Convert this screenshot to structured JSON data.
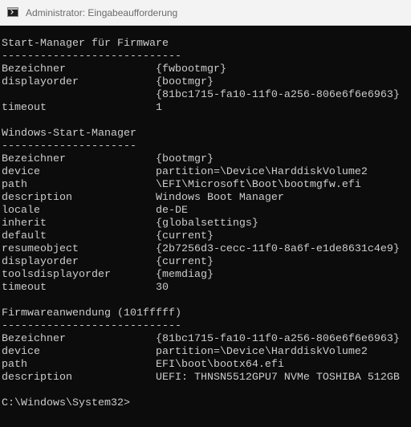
{
  "window": {
    "title": "Administrator: Eingabeaufforderung",
    "icon": "cmd-prompt-icon"
  },
  "console": {
    "lines": [
      "Start-Manager für Firmware",
      "----------------------------",
      "Bezeichner              {fwbootmgr}",
      "displayorder            {bootmgr}",
      "                        {81bc1715-fa10-11f0-a256-806e6f6e6963}",
      "timeout                 1",
      "",
      "Windows-Start-Manager",
      "---------------------",
      "Bezeichner              {bootmgr}",
      "device                  partition=\\Device\\HarddiskVolume2",
      "path                    \\EFI\\Microsoft\\Boot\\bootmgfw.efi",
      "description             Windows Boot Manager",
      "locale                  de-DE",
      "inherit                 {globalsettings}",
      "default                 {current}",
      "resumeobject            {2b7256d3-cecc-11f0-8a6f-e1de8631c4e9}",
      "displayorder            {current}",
      "toolsdisplayorder       {memdiag}",
      "timeout                 30",
      "",
      "Firmwareanwendung (101fffff)",
      "----------------------------",
      "Bezeichner              {81bc1715-fa10-11f0-a256-806e6f6e6963}",
      "device                  partition=\\Device\\HarddiskVolume2",
      "path                    EFI\\boot\\bootx64.efi",
      "description             UEFI: THNSN5512GPU7 NVMe TOSHIBA 512GB",
      "",
      "C:\\Windows\\System32>"
    ]
  },
  "colors": {
    "console_background": "#0c0c0c",
    "console_text": "#cccccc",
    "titlebar_background": "#f3f3f3",
    "title_text": "#6b6b6b"
  }
}
